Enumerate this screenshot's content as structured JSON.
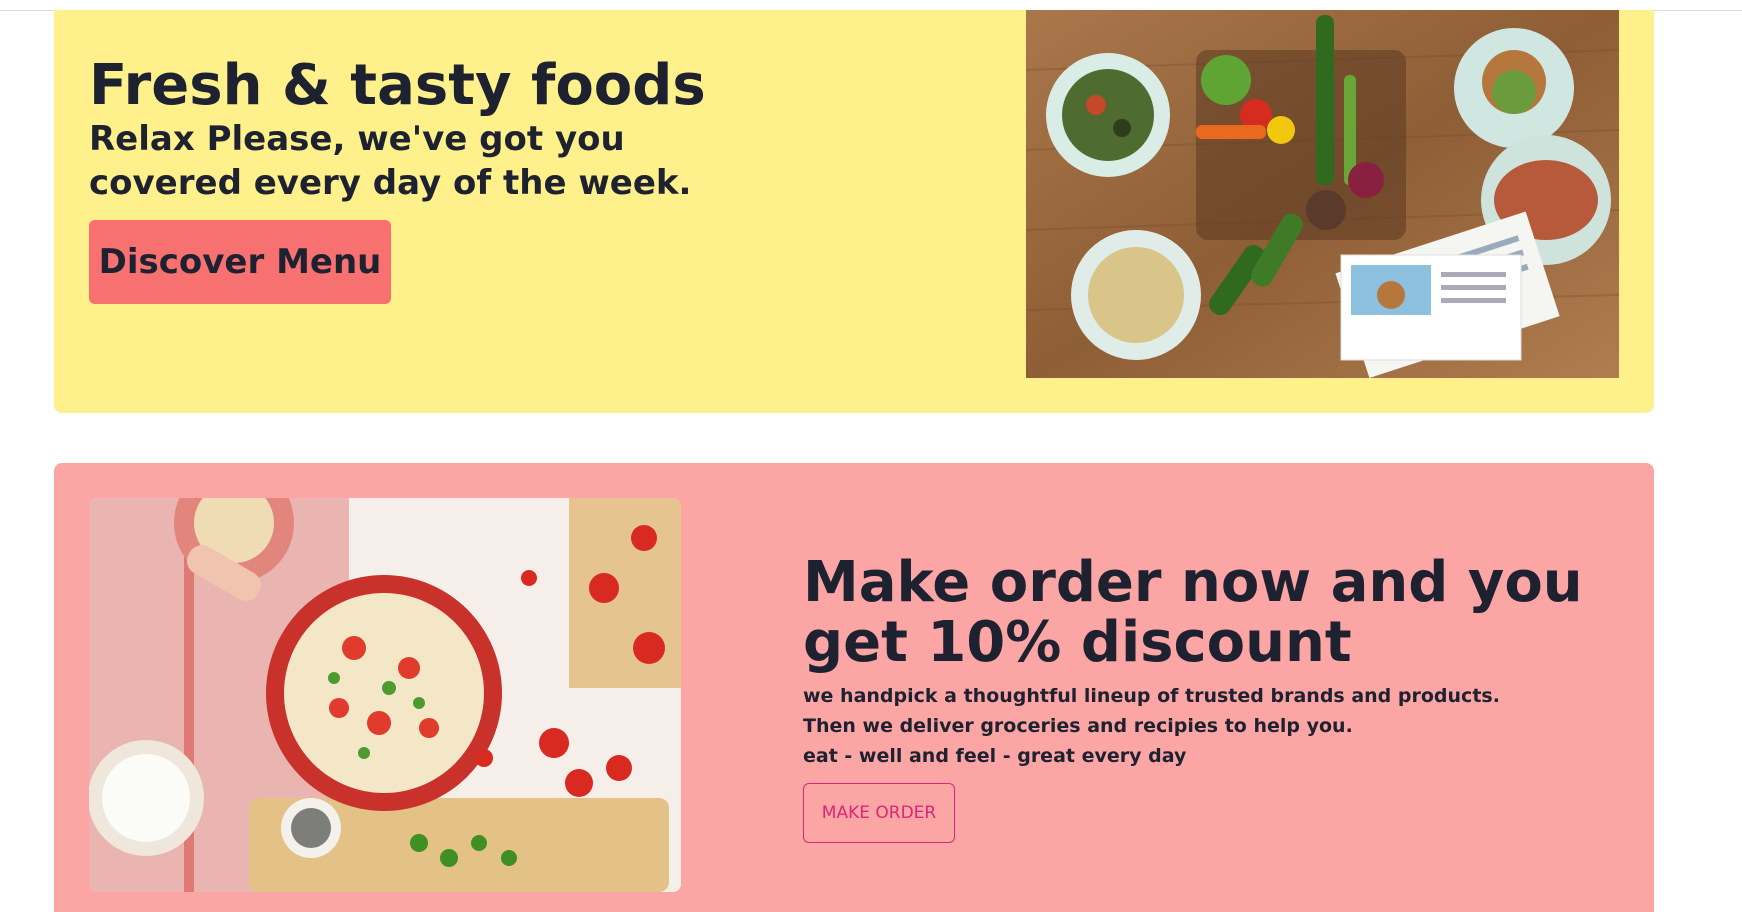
{
  "hero": {
    "title": "Fresh & tasty foods",
    "subtitle": "Relax Please, we've got you covered every day of the week.",
    "button_label": "Discover Menu",
    "background_color": "#fef08a",
    "button_color": "#f87171"
  },
  "promo": {
    "title": "Make order now and you get 10% discount",
    "lines": [
      "we handpick a thoughtful lineup of trusted brands and products.",
      "Then we deliver groceries and recipies to help you.",
      "eat - well and feel - great every day"
    ],
    "button_label": "MAKE ORDER",
    "background_color": "#fca5a5",
    "accent_color": "#db2777"
  },
  "images": {
    "hero_image": "meal-kit-table-photo",
    "promo_image": "pasta-bowl-photo"
  }
}
